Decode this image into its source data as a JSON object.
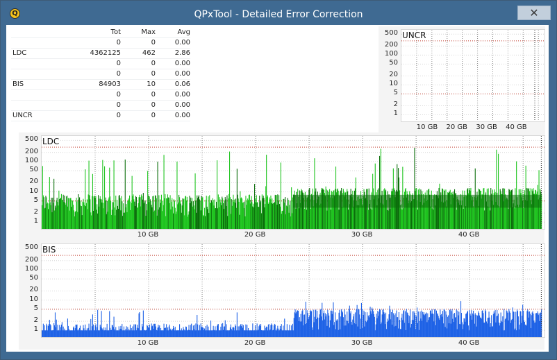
{
  "window": {
    "title": "QPxTool - Detailed Error Correction",
    "close_label": "✕",
    "icon_letter": "Q"
  },
  "stats": {
    "headers": [
      "",
      "Tot",
      "Max",
      "Avg"
    ],
    "rows": [
      {
        "label": "",
        "tot": "0",
        "max": "0",
        "avg": "0.00"
      },
      {
        "label": "LDC",
        "tot": "4362125",
        "max": "462",
        "avg": "2.86"
      },
      {
        "label": "",
        "tot": "0",
        "max": "0",
        "avg": "0.00"
      },
      {
        "label": "",
        "tot": "0",
        "max": "0",
        "avg": "0.00"
      },
      {
        "label": "BIS",
        "tot": "84903",
        "max": "10",
        "avg": "0.06"
      },
      {
        "label": "",
        "tot": "0",
        "max": "0",
        "avg": "0.00"
      },
      {
        "label": "",
        "tot": "0",
        "max": "0",
        "avg": "0.00"
      },
      {
        "label": "UNCR",
        "tot": "0",
        "max": "0",
        "avg": "0.00"
      }
    ]
  },
  "colors": {
    "ldc_light": "#1fc41f",
    "ldc_dark": "#0b6e0b",
    "bis": "#1f62e6",
    "threshold": "#c0392b",
    "grid": "#9a9a9a"
  },
  "chart_data": [
    {
      "type": "area",
      "title": "UNCR",
      "xlabel": "",
      "ylabel": "",
      "y_scale": "log",
      "y_ticks": [
        "500",
        "200",
        "100",
        "50",
        "20",
        "10",
        "5",
        "2",
        "1"
      ],
      "x_ticks": [
        "10 GB",
        "20 GB",
        "30 GB",
        "40 GB"
      ],
      "xlim": [
        0,
        47
      ],
      "values_summary": {
        "max": 0
      },
      "threshold_lines": [
        5,
        300
      ]
    },
    {
      "type": "area",
      "title": "LDC",
      "xlabel": "",
      "ylabel": "",
      "y_scale": "log",
      "y_ticks": [
        "500",
        "200",
        "100",
        "50",
        "20",
        "10",
        "5",
        "2",
        "1"
      ],
      "x_ticks": [
        "10 GB",
        "20 GB",
        "30 GB",
        "40 GB"
      ],
      "xlim": [
        0,
        47
      ],
      "end_marker_gb": 46.7,
      "threshold_lines": [
        5,
        300
      ],
      "series": [
        {
          "x": [
            0,
            23.5
          ],
          "typical": 5,
          "peaks": 250
        },
        {
          "x": [
            23.5,
            47
          ],
          "typical": 8,
          "peaks": 350
        }
      ]
    },
    {
      "type": "area",
      "title": "BIS",
      "xlabel": "",
      "ylabel": "",
      "y_scale": "log",
      "y_ticks": [
        "500",
        "200",
        "100",
        "50",
        "20",
        "10",
        "5",
        "2",
        "1"
      ],
      "x_ticks": [
        "10 GB",
        "20 GB",
        "30 GB",
        "40 GB"
      ],
      "xlim": [
        0,
        47
      ],
      "end_marker_gb": 46.7,
      "threshold_lines": [
        5,
        300
      ],
      "series": [
        {
          "x": [
            0,
            23.5
          ],
          "typical": 1,
          "peaks": 5
        },
        {
          "x": [
            23.5,
            47
          ],
          "typical": 3,
          "peaks": 10
        }
      ]
    }
  ]
}
